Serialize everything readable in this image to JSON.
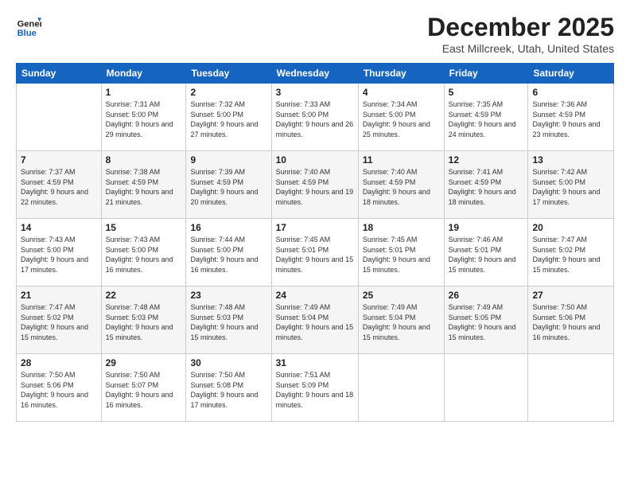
{
  "header": {
    "logo_general": "General",
    "logo_blue": "Blue",
    "title": "December 2025",
    "subtitle": "East Millcreek, Utah, United States"
  },
  "days_of_week": [
    "Sunday",
    "Monday",
    "Tuesday",
    "Wednesday",
    "Thursday",
    "Friday",
    "Saturday"
  ],
  "weeks": [
    [
      {
        "day": "",
        "sunrise": "",
        "sunset": "",
        "daylight": ""
      },
      {
        "day": "1",
        "sunrise": "Sunrise: 7:31 AM",
        "sunset": "Sunset: 5:00 PM",
        "daylight": "Daylight: 9 hours and 29 minutes."
      },
      {
        "day": "2",
        "sunrise": "Sunrise: 7:32 AM",
        "sunset": "Sunset: 5:00 PM",
        "daylight": "Daylight: 9 hours and 27 minutes."
      },
      {
        "day": "3",
        "sunrise": "Sunrise: 7:33 AM",
        "sunset": "Sunset: 5:00 PM",
        "daylight": "Daylight: 9 hours and 26 minutes."
      },
      {
        "day": "4",
        "sunrise": "Sunrise: 7:34 AM",
        "sunset": "Sunset: 5:00 PM",
        "daylight": "Daylight: 9 hours and 25 minutes."
      },
      {
        "day": "5",
        "sunrise": "Sunrise: 7:35 AM",
        "sunset": "Sunset: 4:59 PM",
        "daylight": "Daylight: 9 hours and 24 minutes."
      },
      {
        "day": "6",
        "sunrise": "Sunrise: 7:36 AM",
        "sunset": "Sunset: 4:59 PM",
        "daylight": "Daylight: 9 hours and 23 minutes."
      }
    ],
    [
      {
        "day": "7",
        "sunrise": "Sunrise: 7:37 AM",
        "sunset": "Sunset: 4:59 PM",
        "daylight": "Daylight: 9 hours and 22 minutes."
      },
      {
        "day": "8",
        "sunrise": "Sunrise: 7:38 AM",
        "sunset": "Sunset: 4:59 PM",
        "daylight": "Daylight: 9 hours and 21 minutes."
      },
      {
        "day": "9",
        "sunrise": "Sunrise: 7:39 AM",
        "sunset": "Sunset: 4:59 PM",
        "daylight": "Daylight: 9 hours and 20 minutes."
      },
      {
        "day": "10",
        "sunrise": "Sunrise: 7:40 AM",
        "sunset": "Sunset: 4:59 PM",
        "daylight": "Daylight: 9 hours and 19 minutes."
      },
      {
        "day": "11",
        "sunrise": "Sunrise: 7:40 AM",
        "sunset": "Sunset: 4:59 PM",
        "daylight": "Daylight: 9 hours and 18 minutes."
      },
      {
        "day": "12",
        "sunrise": "Sunrise: 7:41 AM",
        "sunset": "Sunset: 4:59 PM",
        "daylight": "Daylight: 9 hours and 18 minutes."
      },
      {
        "day": "13",
        "sunrise": "Sunrise: 7:42 AM",
        "sunset": "Sunset: 5:00 PM",
        "daylight": "Daylight: 9 hours and 17 minutes."
      }
    ],
    [
      {
        "day": "14",
        "sunrise": "Sunrise: 7:43 AM",
        "sunset": "Sunset: 5:00 PM",
        "daylight": "Daylight: 9 hours and 17 minutes."
      },
      {
        "day": "15",
        "sunrise": "Sunrise: 7:43 AM",
        "sunset": "Sunset: 5:00 PM",
        "daylight": "Daylight: 9 hours and 16 minutes."
      },
      {
        "day": "16",
        "sunrise": "Sunrise: 7:44 AM",
        "sunset": "Sunset: 5:00 PM",
        "daylight": "Daylight: 9 hours and 16 minutes."
      },
      {
        "day": "17",
        "sunrise": "Sunrise: 7:45 AM",
        "sunset": "Sunset: 5:01 PM",
        "daylight": "Daylight: 9 hours and 15 minutes."
      },
      {
        "day": "18",
        "sunrise": "Sunrise: 7:45 AM",
        "sunset": "Sunset: 5:01 PM",
        "daylight": "Daylight: 9 hours and 15 minutes."
      },
      {
        "day": "19",
        "sunrise": "Sunrise: 7:46 AM",
        "sunset": "Sunset: 5:01 PM",
        "daylight": "Daylight: 9 hours and 15 minutes."
      },
      {
        "day": "20",
        "sunrise": "Sunrise: 7:47 AM",
        "sunset": "Sunset: 5:02 PM",
        "daylight": "Daylight: 9 hours and 15 minutes."
      }
    ],
    [
      {
        "day": "21",
        "sunrise": "Sunrise: 7:47 AM",
        "sunset": "Sunset: 5:02 PM",
        "daylight": "Daylight: 9 hours and 15 minutes."
      },
      {
        "day": "22",
        "sunrise": "Sunrise: 7:48 AM",
        "sunset": "Sunset: 5:03 PM",
        "daylight": "Daylight: 9 hours and 15 minutes."
      },
      {
        "day": "23",
        "sunrise": "Sunrise: 7:48 AM",
        "sunset": "Sunset: 5:03 PM",
        "daylight": "Daylight: 9 hours and 15 minutes."
      },
      {
        "day": "24",
        "sunrise": "Sunrise: 7:49 AM",
        "sunset": "Sunset: 5:04 PM",
        "daylight": "Daylight: 9 hours and 15 minutes."
      },
      {
        "day": "25",
        "sunrise": "Sunrise: 7:49 AM",
        "sunset": "Sunset: 5:04 PM",
        "daylight": "Daylight: 9 hours and 15 minutes."
      },
      {
        "day": "26",
        "sunrise": "Sunrise: 7:49 AM",
        "sunset": "Sunset: 5:05 PM",
        "daylight": "Daylight: 9 hours and 15 minutes."
      },
      {
        "day": "27",
        "sunrise": "Sunrise: 7:50 AM",
        "sunset": "Sunset: 5:06 PM",
        "daylight": "Daylight: 9 hours and 16 minutes."
      }
    ],
    [
      {
        "day": "28",
        "sunrise": "Sunrise: 7:50 AM",
        "sunset": "Sunset: 5:06 PM",
        "daylight": "Daylight: 9 hours and 16 minutes."
      },
      {
        "day": "29",
        "sunrise": "Sunrise: 7:50 AM",
        "sunset": "Sunset: 5:07 PM",
        "daylight": "Daylight: 9 hours and 16 minutes."
      },
      {
        "day": "30",
        "sunrise": "Sunrise: 7:50 AM",
        "sunset": "Sunset: 5:08 PM",
        "daylight": "Daylight: 9 hours and 17 minutes."
      },
      {
        "day": "31",
        "sunrise": "Sunrise: 7:51 AM",
        "sunset": "Sunset: 5:09 PM",
        "daylight": "Daylight: 9 hours and 18 minutes."
      },
      {
        "day": "",
        "sunrise": "",
        "sunset": "",
        "daylight": ""
      },
      {
        "day": "",
        "sunrise": "",
        "sunset": "",
        "daylight": ""
      },
      {
        "day": "",
        "sunrise": "",
        "sunset": "",
        "daylight": ""
      }
    ]
  ]
}
